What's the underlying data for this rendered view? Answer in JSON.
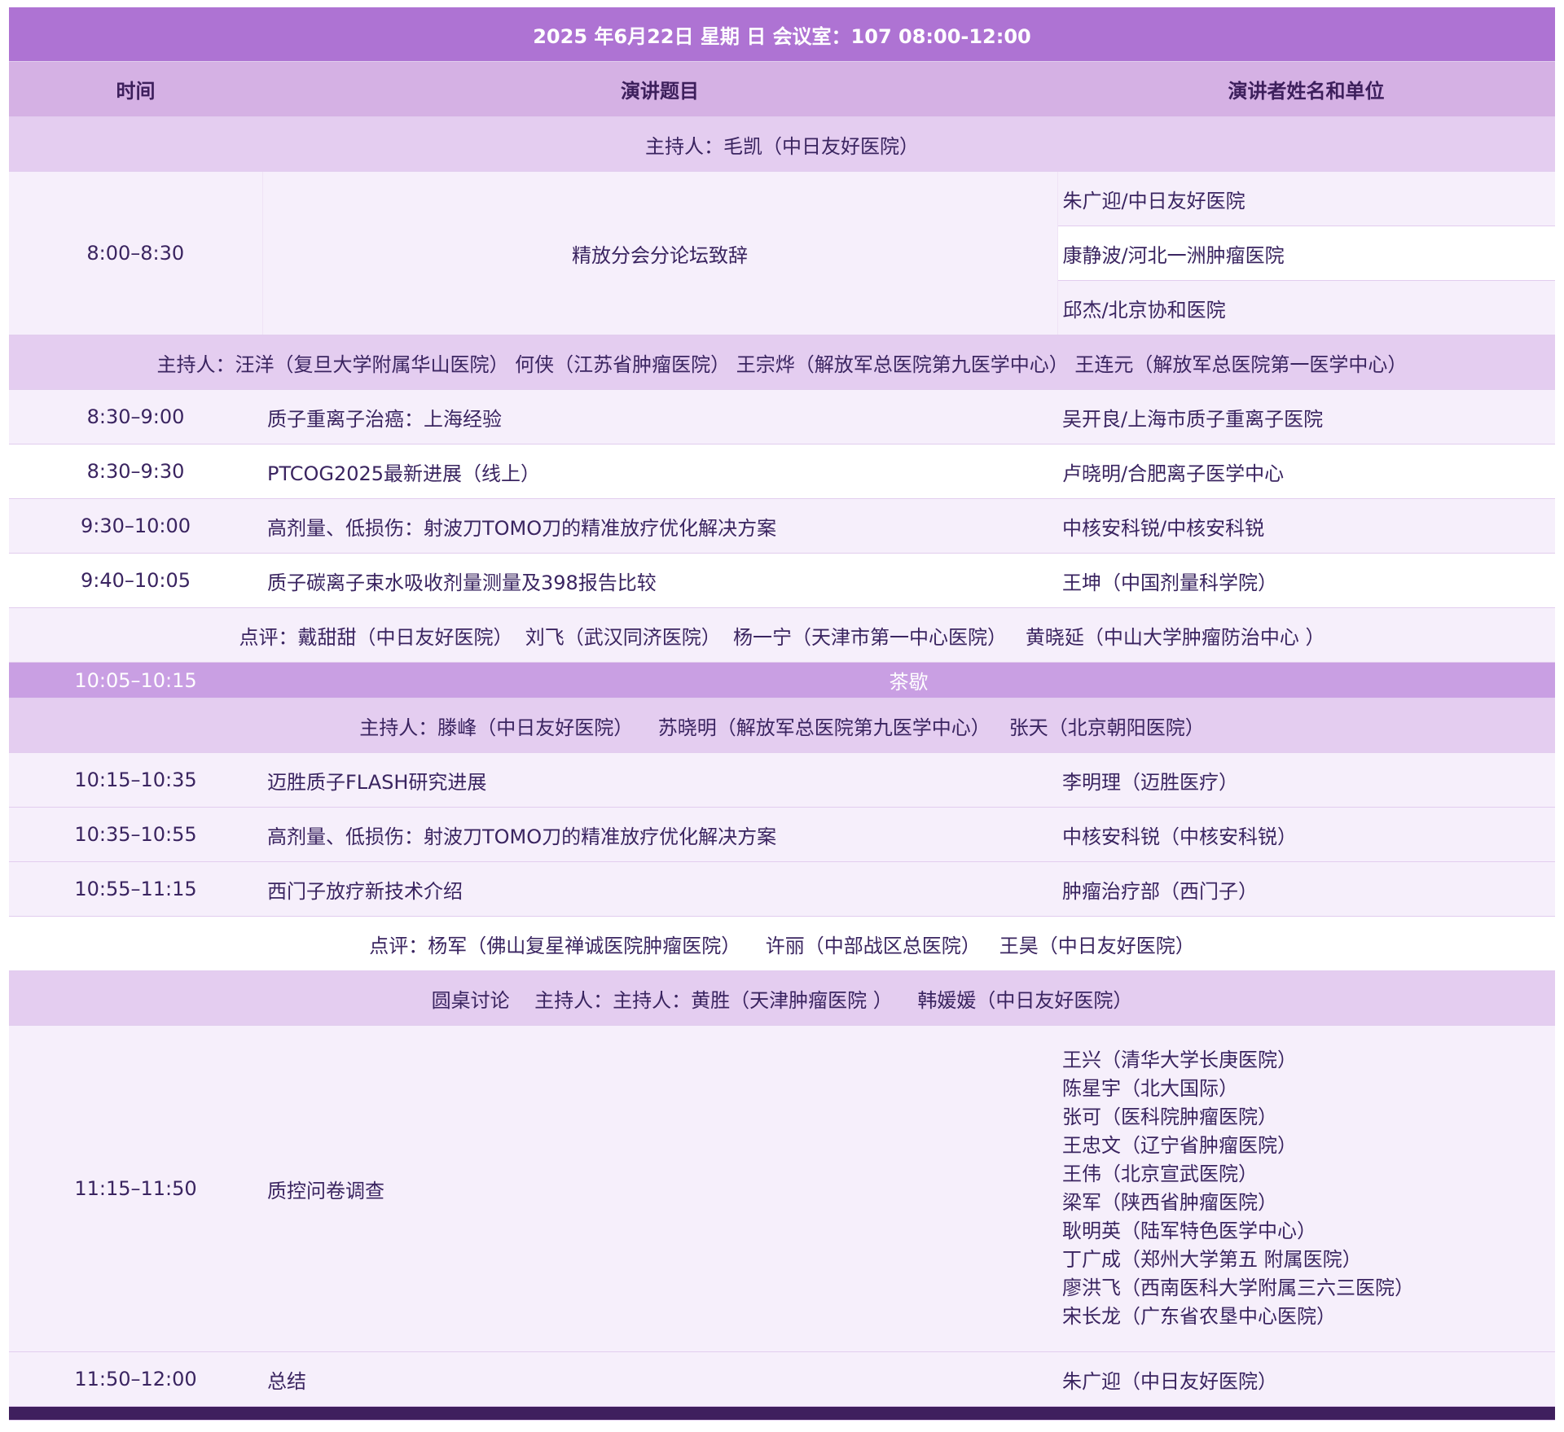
{
  "header": {
    "title": "2025 年6月22日  星期 日  会议室：107      08:00-12:00"
  },
  "columns": {
    "time": "时间",
    "title": "演讲题目",
    "speaker": "演讲者姓名和单位"
  },
  "session1": {
    "host": "主持人：毛凯（中日友好医院）",
    "opening": {
      "time": "8:00–8:30",
      "title": "精放分会分论坛致辞",
      "speakers": [
        "朱广迎/中日友好医院",
        "康静波/河北一洲肿瘤医院",
        "邱杰/北京协和医院"
      ]
    }
  },
  "session2": {
    "host": "主持人：汪洋（复旦大学附属华山医院）    何侠（江苏省肿瘤医院）    王宗烨（解放军总医院第九医学中心） 王连元（解放军总医院第一医学中心）",
    "talks": [
      {
        "time": "8:30–9:00",
        "title": "质子重离子治癌：上海经验",
        "speaker": "吴开良/上海市质子重离子医院"
      },
      {
        "time": "8:30–9:30",
        "title": "PTCOG2025最新进展（线上）",
        "speaker": "卢晓明/合肥离子医学中心"
      },
      {
        "time": "9:30–10:00",
        "title": "高剂量、低损伤：射波刀TOMO刀的精准放疗优化解决方案",
        "speaker": "中核安科锐/中核安科锐"
      },
      {
        "time": "9:40–10:05",
        "title": "质子碳离子束水吸收剂量测量及398报告比较",
        "speaker": "王坤（中国剂量科学院）"
      }
    ],
    "comment": "点评：戴甜甜（中日友好医院）  刘飞（武汉同济医院）  杨一宁（天津市第一中心医院）   黄晓延（中山大学肿瘤防治中心 ）"
  },
  "break": {
    "time": "10:05–10:15",
    "label": "茶歇"
  },
  "session3": {
    "host": "主持人：滕峰（中日友好医院）    苏晓明（解放军总医院第九医学中心）   张天（北京朝阳医院）",
    "talks": [
      {
        "time": "10:15–10:35",
        "title": "迈胜质子FLASH研究进展",
        "speaker": "李明理（迈胜医疗）"
      },
      {
        "time": "10:35–10:55",
        "title": "高剂量、低损伤：射波刀TOMO刀的精准放疗优化解决方案",
        "speaker": "中核安科锐（中核安科锐）"
      },
      {
        "time": "10:55–11:15",
        "title": "西门子放疗新技术介绍",
        "speaker": "肿瘤治疗部（西门子）"
      }
    ],
    "comment": "点评：杨军（佛山复星禅诚医院肿瘤医院）    许丽（中部战区总医院）   王昊（中日友好医院）"
  },
  "session4": {
    "host": "圆桌讨论    主持人：主持人：黄胜（天津肿瘤医院 ）    韩媛媛（中日友好医院）",
    "panel": {
      "time": "11:15–11:50",
      "title": "质控问卷调查",
      "speakers": [
        "王兴（清华大学长庚医院）",
        "陈星宇（北大国际）",
        "张可（医科院肿瘤医院）",
        "王忠文（辽宁省肿瘤医院）",
        "王伟（北京宣武医院）",
        "梁军（陕西省肿瘤医院）",
        "耿明英（陆军特色医学中心）",
        "丁广成（郑州大学第五 附属医院）",
        "廖洪飞（西南医科大学附属三六三医院）",
        "宋长龙（广东省农垦中心医院）"
      ]
    },
    "summary": {
      "time": "11:50–12:00",
      "title": "总结",
      "speaker": "朱广迎（中日友好医院）"
    }
  }
}
